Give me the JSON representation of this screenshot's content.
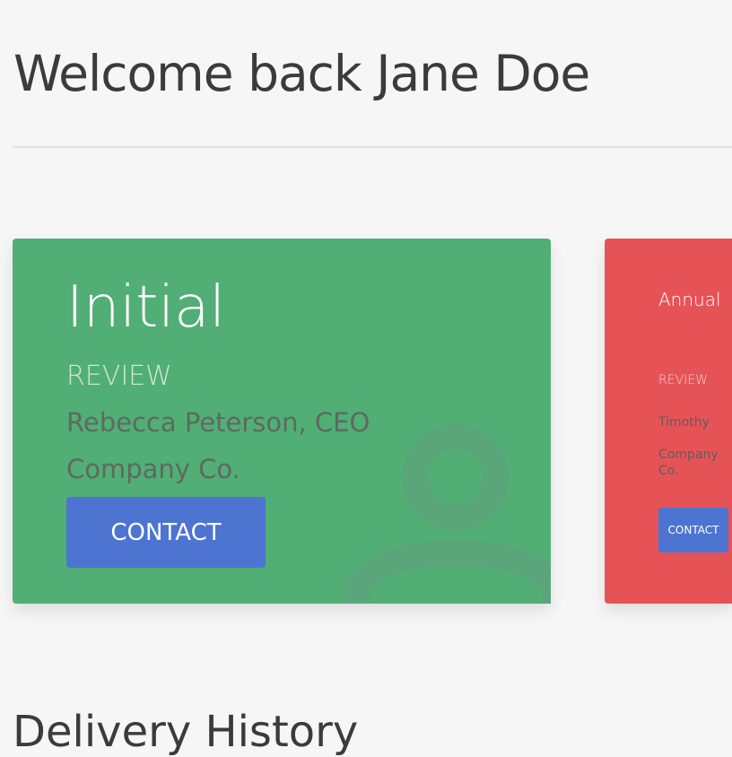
{
  "header": {
    "title": "Welcome back Jane Doe"
  },
  "cards": [
    {
      "title": "Initial",
      "subtitle": "REVIEW",
      "name": "Rebecca Peterson, CEO",
      "company": "Company Co.",
      "button": "CONTACT",
      "color": "#51ae75"
    },
    {
      "title": "Annual",
      "subtitle": "REVIEW",
      "name": "Timothy",
      "company": "Company Co.",
      "button": "CONTACT",
      "color": "#e65357"
    }
  ],
  "section": {
    "title": "Delivery History"
  },
  "colors": {
    "button": "#4d74d1",
    "background": "#f6f6f6"
  }
}
